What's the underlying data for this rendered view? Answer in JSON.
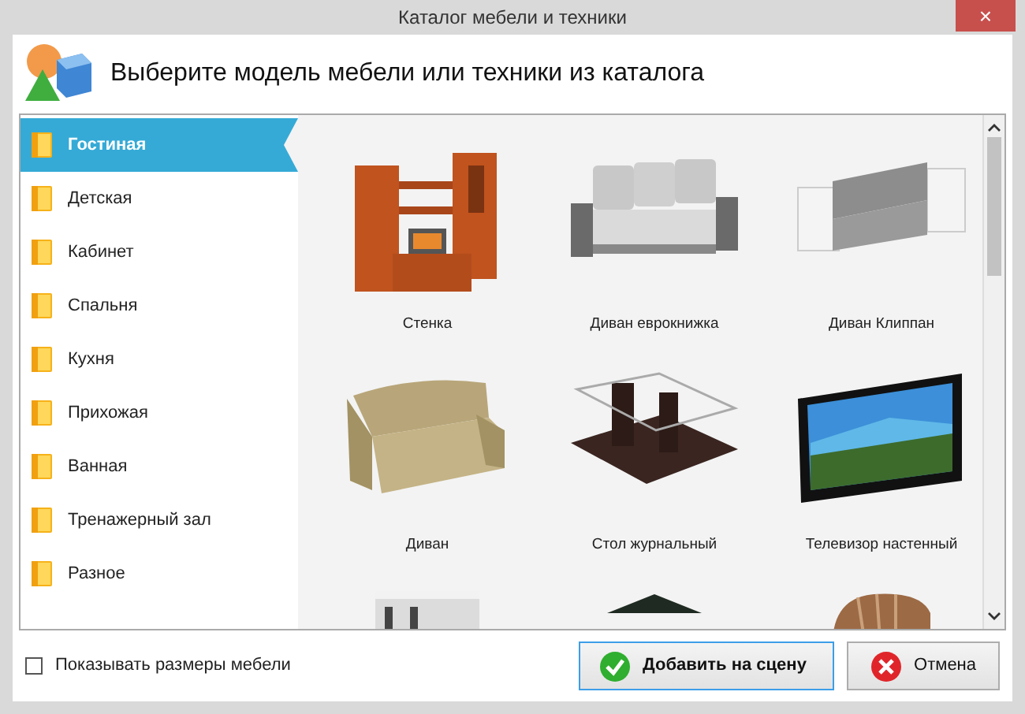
{
  "window": {
    "title": "Каталог мебели и техники",
    "close": "×"
  },
  "header": {
    "text": "Выберите модель мебели или техники из каталога"
  },
  "sidebar": {
    "items": [
      {
        "label": "Гостиная",
        "selected": true
      },
      {
        "label": "Детская",
        "selected": false
      },
      {
        "label": "Кабинет",
        "selected": false
      },
      {
        "label": "Спальня",
        "selected": false
      },
      {
        "label": "Кухня",
        "selected": false
      },
      {
        "label": "Прихожая",
        "selected": false
      },
      {
        "label": "Ванная",
        "selected": false
      },
      {
        "label": "Тренажерный зал",
        "selected": false
      },
      {
        "label": "Разное",
        "selected": false
      }
    ]
  },
  "catalog": {
    "items": [
      {
        "kind": "wallunit",
        "label": "Стенка"
      },
      {
        "kind": "sofa3",
        "label": "Диван еврокнижка"
      },
      {
        "kind": "sofa2",
        "label": "Диван Клиппан"
      },
      {
        "kind": "couch",
        "label": "Диван"
      },
      {
        "kind": "table",
        "label": "Стол журнальный"
      },
      {
        "kind": "tv",
        "label": "Телевизор настенный"
      },
      {
        "kind": "cabinet"
      },
      {
        "kind": "dark"
      },
      {
        "kind": "armchair"
      }
    ]
  },
  "footer": {
    "checkbox": {
      "label": "Показывать размеры мебели",
      "checked": false
    },
    "buttons": [
      {
        "kind": "ok",
        "label": "Добавить на сцену"
      },
      {
        "kind": "cancel",
        "label": "Отмена"
      }
    ]
  }
}
